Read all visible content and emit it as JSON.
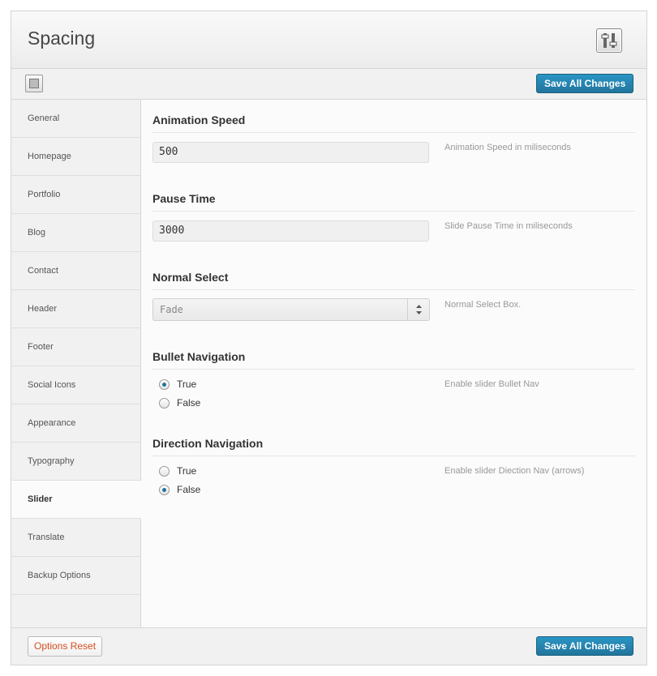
{
  "header": {
    "title": "Spacing",
    "icon": "sliders-icon"
  },
  "toolbar": {
    "save_label": "Save All Changes"
  },
  "sidebar": {
    "items": [
      {
        "label": "General"
      },
      {
        "label": "Homepage"
      },
      {
        "label": "Portfolio"
      },
      {
        "label": "Blog"
      },
      {
        "label": "Contact"
      },
      {
        "label": "Header"
      },
      {
        "label": "Footer"
      },
      {
        "label": "Social Icons"
      },
      {
        "label": "Appearance"
      },
      {
        "label": "Typography"
      },
      {
        "label": "Slider",
        "active": true
      },
      {
        "label": "Translate"
      },
      {
        "label": "Backup Options"
      }
    ]
  },
  "main": {
    "animation_speed": {
      "title": "Animation Speed",
      "value": "500",
      "help": "Animation Speed in miliseconds"
    },
    "pause_time": {
      "title": "Pause Time",
      "value": "3000",
      "help": "Slide Pause Time in miliseconds"
    },
    "normal_select": {
      "title": "Normal Select",
      "value": "Fade",
      "help": "Normal Select Box."
    },
    "bullet_navigation": {
      "title": "Bullet Navigation",
      "help": "Enable slider Bullet Nav",
      "options": [
        "True",
        "False"
      ],
      "selected": "True"
    },
    "direction_navigation": {
      "title": "Direction Navigation",
      "help": "Enable slider Diection Nav (arrows)",
      "options": [
        "True",
        "False"
      ],
      "selected": "False"
    }
  },
  "footer": {
    "reset_label": "Options Reset",
    "save_label": "Save All Changes"
  },
  "colors": {
    "accent": "#21759b",
    "reset_text": "#d54e21"
  }
}
